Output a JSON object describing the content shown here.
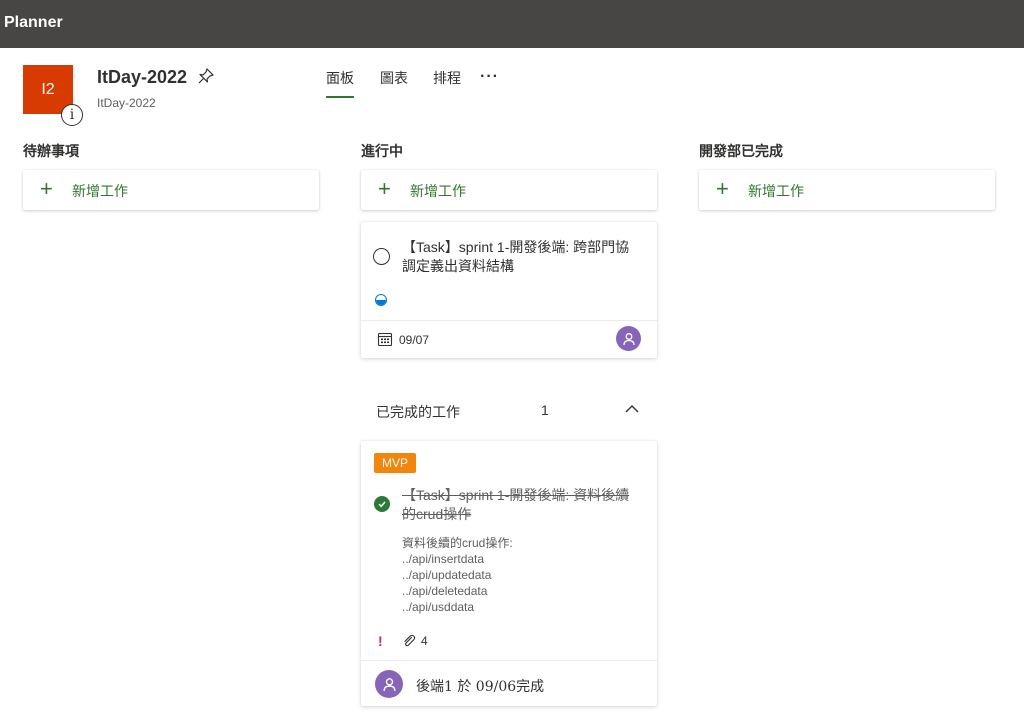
{
  "app": {
    "title": "Planner"
  },
  "plan": {
    "initials": "I2",
    "name": "ItDay-2022",
    "subtitle": "ItDay-2022",
    "avatar_color": "#d83b01"
  },
  "tabs": [
    {
      "label": "面板",
      "active": true
    },
    {
      "label": "圖表",
      "active": false
    },
    {
      "label": "排程",
      "active": false
    }
  ],
  "more_label": "···",
  "columns": [
    {
      "title": "待辦事項",
      "add_label": "新增工作"
    },
    {
      "title": "進行中",
      "add_label": "新增工作"
    },
    {
      "title": "開發部已完成",
      "add_label": "新增工作"
    }
  ],
  "in_progress_task": {
    "title_line1": "【Task】sprint 1-開發後端: 跨部門協",
    "title_line2": "調定義出資料結構",
    "progress_icon": "half-circle-progress-icon",
    "due_date": "09/07"
  },
  "completed_section": {
    "label": "已完成的工作",
    "count": "1"
  },
  "completed_task": {
    "label": "MVP",
    "label_color": "#f2860c",
    "title_line1": "【Task】sprint 1-開發後端: 資料後續",
    "title_line2": "的crud操作",
    "description": [
      "資料後續的crud操作:",
      "../api/insertdata",
      "../api/updatedata",
      "../api/deletedata",
      "../api/usddata"
    ],
    "priority_icon": "!",
    "attachments": "4",
    "completed_by": "後端1  於 09/06完成"
  },
  "colors": {
    "accent_green": "#31752f",
    "topbar": "#474644",
    "avatar_purple": "#8764b8"
  }
}
